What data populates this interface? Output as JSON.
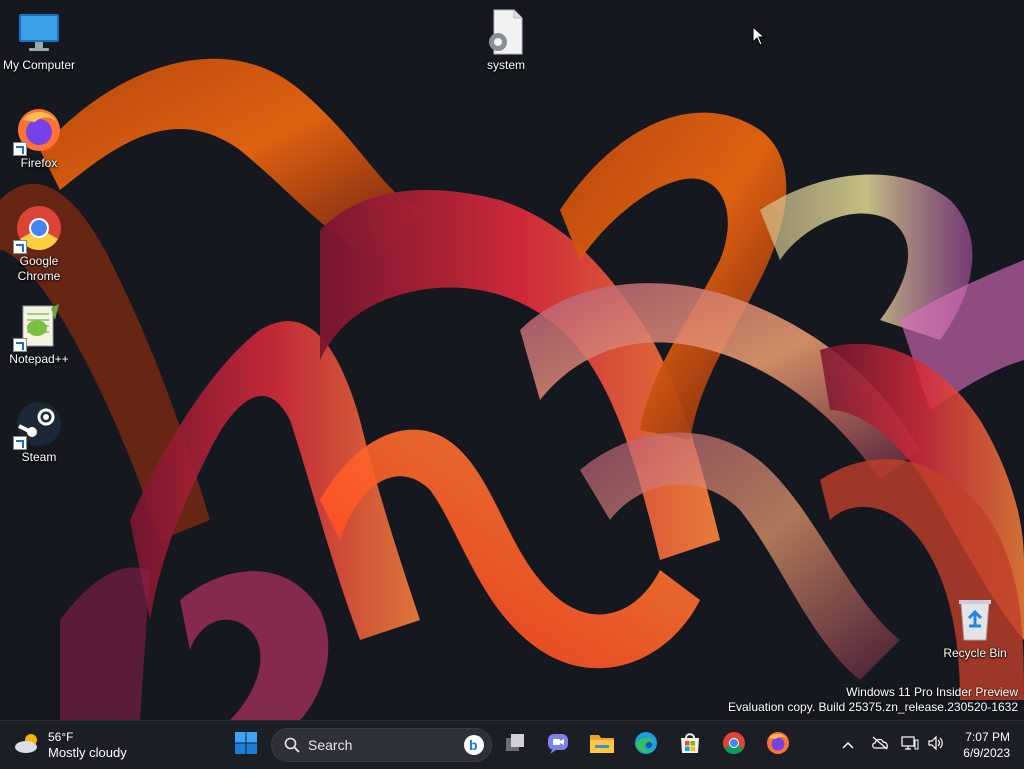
{
  "desktop": {
    "icons": [
      {
        "label": "My Computer",
        "icon": "monitor-icon"
      },
      {
        "label": "system",
        "icon": "settings-file-icon"
      },
      {
        "label": "Firefox",
        "icon": "firefox-icon"
      },
      {
        "label": "Google Chrome",
        "icon": "chrome-icon"
      },
      {
        "label": "Notepad++",
        "icon": "notepadpp-icon"
      },
      {
        "label": "Steam",
        "icon": "steam-icon"
      },
      {
        "label": "Recycle Bin",
        "icon": "recycle-bin-icon"
      }
    ],
    "watermark_line1": "Windows 11 Pro Insider Preview",
    "watermark_line2": "Evaluation copy. Build 25375.zn_release.230520-1632"
  },
  "taskbar": {
    "weather": {
      "temp": "56°F",
      "condition": "Mostly cloudy"
    },
    "search_label": "Search",
    "pinned": [
      "start-icon",
      "task-view-icon",
      "teams-chat-icon",
      "file-explorer-icon",
      "edge-icon",
      "store-icon",
      "chrome-icon",
      "firefox-icon"
    ],
    "tray": [
      "chevron-up-icon",
      "onedrive-icon",
      "network-icon",
      "volume-icon"
    ],
    "clock": {
      "time": "7:07 PM",
      "date": "6/9/2023"
    }
  },
  "colors": {
    "accent": "#0078d4",
    "taskbar_bg": "#1c1e26",
    "wallpaper_bg": "#161820"
  }
}
